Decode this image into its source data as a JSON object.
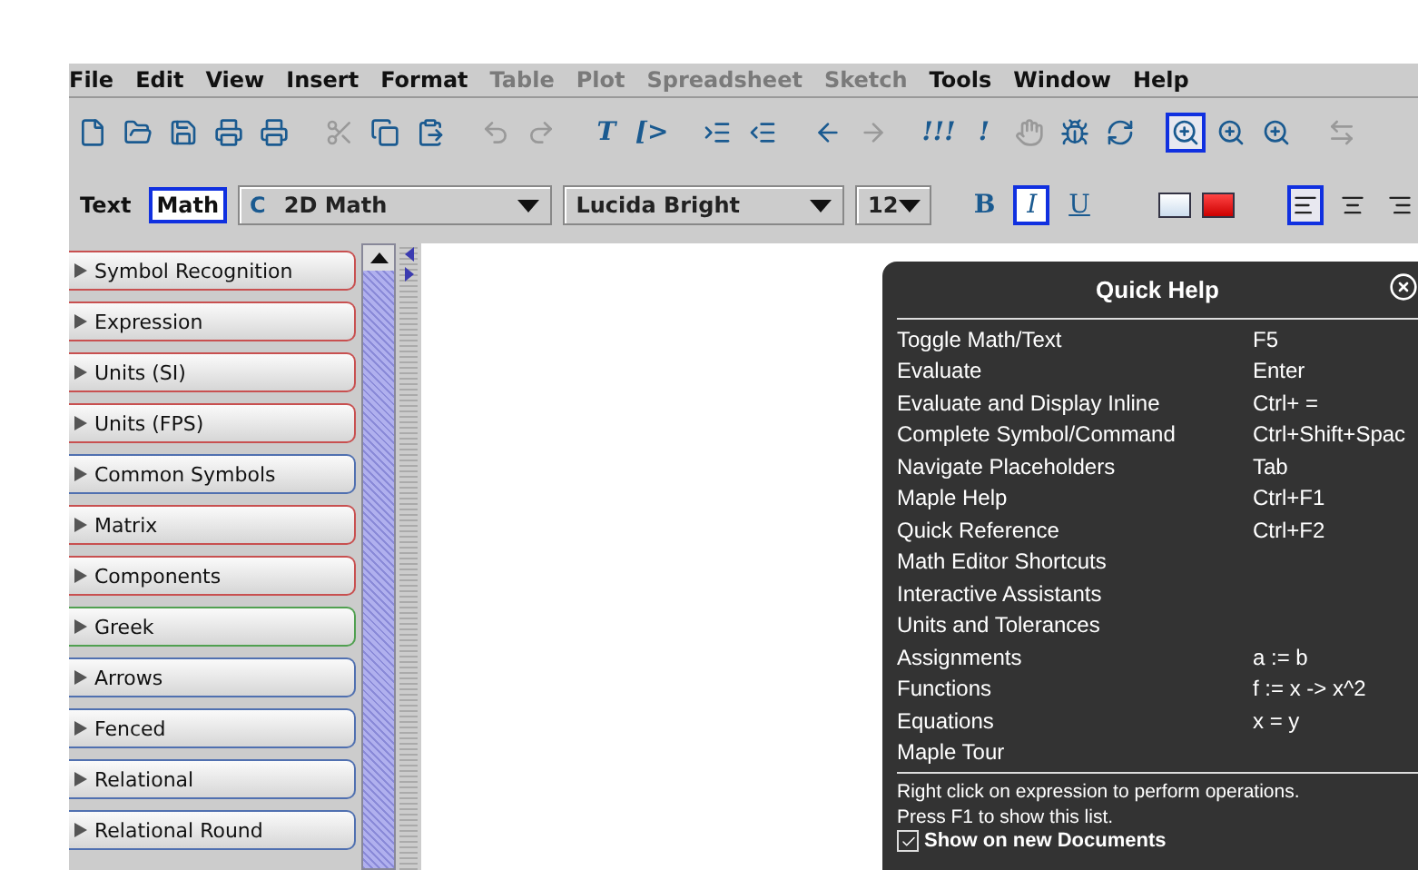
{
  "menu": [
    {
      "label": "File",
      "disabled": false
    },
    {
      "label": "Edit",
      "disabled": false
    },
    {
      "label": "View",
      "disabled": false
    },
    {
      "label": "Insert",
      "disabled": false
    },
    {
      "label": "Format",
      "disabled": false
    },
    {
      "label": "Table",
      "disabled": true
    },
    {
      "label": "Plot",
      "disabled": true
    },
    {
      "label": "Spreadsheet",
      "disabled": true
    },
    {
      "label": "Sketch",
      "disabled": true
    },
    {
      "label": "Tools",
      "disabled": false
    },
    {
      "label": "Window",
      "disabled": false
    },
    {
      "label": "Help",
      "disabled": false
    }
  ],
  "toolbar": [
    [
      {
        "kind": "new",
        "disabled": false,
        "selected": false
      },
      {
        "kind": "open",
        "disabled": false,
        "selected": false
      },
      {
        "kind": "save",
        "disabled": false,
        "selected": false
      },
      {
        "kind": "print",
        "disabled": false,
        "selected": false
      },
      {
        "kind": "preview",
        "disabled": false,
        "selected": false
      }
    ],
    [
      {
        "kind": "cut",
        "disabled": true,
        "selected": false
      },
      {
        "kind": "copy",
        "disabled": false,
        "selected": false
      },
      {
        "kind": "paste",
        "disabled": false,
        "selected": false
      }
    ],
    [
      {
        "kind": "undo",
        "disabled": true,
        "selected": false
      },
      {
        "kind": "redo",
        "disabled": true,
        "selected": false
      }
    ],
    [
      {
        "kind": "glyph",
        "glyph": "T",
        "disabled": false,
        "selected": false
      },
      {
        "kind": "glyph",
        "glyph": "[>",
        "disabled": false,
        "selected": false
      }
    ],
    [
      {
        "kind": "indent",
        "disabled": false,
        "selected": false
      },
      {
        "kind": "outdent",
        "disabled": false,
        "selected": false
      }
    ],
    [
      {
        "kind": "back",
        "disabled": false,
        "selected": false
      },
      {
        "kind": "forward",
        "disabled": true,
        "selected": false
      }
    ],
    [
      {
        "kind": "glyph",
        "glyph": "!!!",
        "disabled": false,
        "selected": false
      },
      {
        "kind": "glyph",
        "glyph": "!",
        "disabled": false,
        "selected": false
      },
      {
        "kind": "stop",
        "disabled": true,
        "selected": false
      },
      {
        "kind": "debug",
        "disabled": false,
        "selected": false
      },
      {
        "kind": "restart",
        "disabled": false,
        "selected": false
      }
    ],
    [
      {
        "kind": "zoom",
        "disabled": false,
        "selected": true
      },
      {
        "kind": "zoom",
        "disabled": false,
        "selected": false
      },
      {
        "kind": "zoom",
        "disabled": false,
        "selected": false
      }
    ],
    [
      {
        "kind": "swap",
        "disabled": true,
        "selected": false
      }
    ]
  ],
  "format_bar": {
    "modes": [
      {
        "label": "Text",
        "selected": false
      },
      {
        "label": "Math",
        "selected": true
      }
    ],
    "style": {
      "icon": "C",
      "value": "2D Math"
    },
    "font": {
      "value": "Lucida Bright"
    },
    "size": {
      "value": "12"
    },
    "styles": [
      {
        "kind": "bold",
        "glyph": "B",
        "selected": false
      },
      {
        "kind": "italic",
        "glyph": "I",
        "selected": true
      },
      {
        "kind": "underline",
        "glyph": "U",
        "selected": false
      }
    ],
    "colors": [
      {
        "kind": "text-color"
      },
      {
        "kind": "highlight-color"
      }
    ],
    "align": [
      {
        "kind": "left",
        "selected": true
      },
      {
        "kind": "center",
        "selected": false
      },
      {
        "kind": "right",
        "selected": false
      }
    ]
  },
  "palettes": [
    {
      "name": "Symbol Recognition",
      "color": "#c85050"
    },
    {
      "name": "Expression",
      "color": "#c85050"
    },
    {
      "name": "Units (SI)",
      "color": "#c85050"
    },
    {
      "name": "Units (FPS)",
      "color": "#c85050"
    },
    {
      "name": "Common Symbols",
      "color": "#5070b0"
    },
    {
      "name": "Matrix",
      "color": "#c85050"
    },
    {
      "name": "Components",
      "color": "#c85050"
    },
    {
      "name": "Greek",
      "color": "#50a050"
    },
    {
      "name": "Arrows",
      "color": "#5070b0"
    },
    {
      "name": "Fenced",
      "color": "#5070b0"
    },
    {
      "name": "Relational",
      "color": "#5070b0"
    },
    {
      "name": "Relational Round",
      "color": "#5070b0"
    }
  ],
  "quick_help": {
    "title": "Quick Help",
    "rows": [
      {
        "action": "Toggle Math/Text",
        "key": "F5"
      },
      {
        "action": "Evaluate",
        "key": "Enter"
      },
      {
        "action": "Evaluate and Display Inline",
        "key": "Ctrl+ ="
      },
      {
        "action": "Complete Symbol/Command",
        "key": "Ctrl+Shift+Spac"
      },
      {
        "action": "Navigate Placeholders",
        "key": "Tab"
      },
      {
        "action": "Maple Help",
        "key": "Ctrl+F1"
      },
      {
        "action": "Quick Reference",
        "key": "Ctrl+F2"
      },
      {
        "action": "Math Editor Shortcuts"
      },
      {
        "action": "Interactive Assistants"
      },
      {
        "action": "Units and Tolerances"
      },
      {
        "action": "Assignments",
        "key": "a := b"
      },
      {
        "action": "Functions",
        "key": "f := x -> x^2"
      },
      {
        "action": "Equations",
        "key": "x = y"
      },
      {
        "action": "Maple Tour"
      }
    ],
    "notes": [
      "Right click on expression to perform operations.",
      "Press F1 to show this list."
    ],
    "show_on_new": {
      "label": "Show on new Documents",
      "checked": true
    }
  }
}
